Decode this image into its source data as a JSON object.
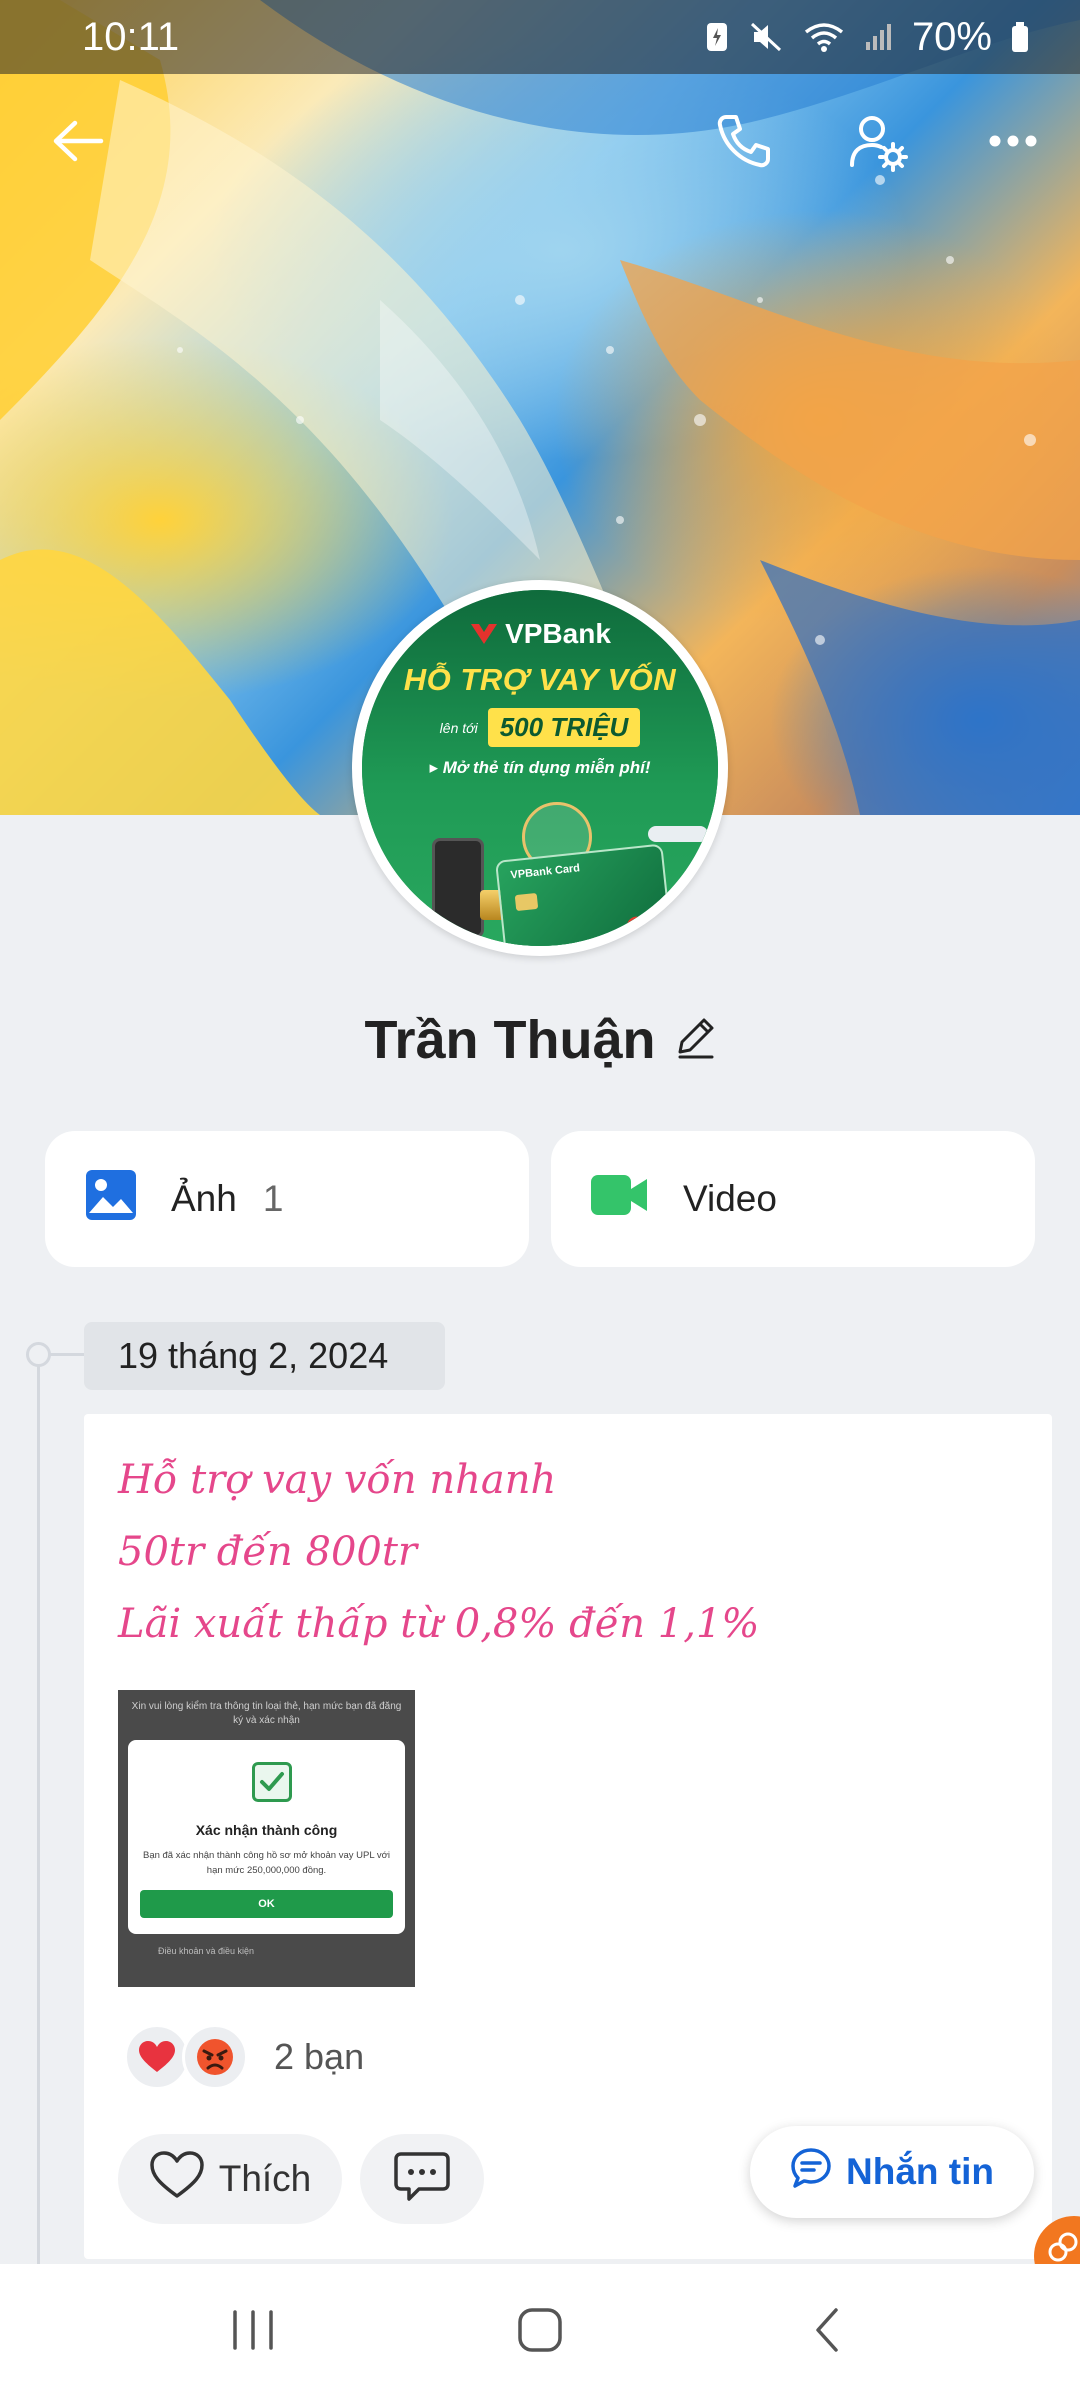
{
  "status_bar": {
    "time": "10:11",
    "battery": "70%"
  },
  "profile": {
    "name": "Trần Thuận"
  },
  "avatar_ad": {
    "brand": "VPBank",
    "headline": "HỖ TRỢ VAY VỐN",
    "prefix": "lên tới",
    "amount": "500 TRIỆU",
    "subline": "▸ Mở thẻ tín dụng miễn phí!",
    "card_label": "VPBank Card"
  },
  "media": {
    "photos_label": "Ảnh",
    "photos_count": "1",
    "video_label": "Video"
  },
  "timeline": {
    "date": "19 tháng 2, 2024"
  },
  "post": {
    "lines": [
      "Hỗ trợ vay vốn nhanh",
      "50tr đến 800tr",
      "Lãi xuất thấp từ 0,8% đến 1,1%"
    ],
    "image": {
      "top_text": "Xin vui lòng kiểm tra thông tin loại thẻ, hạn mức bạn đã đăng ký và xác nhận",
      "dialog_title": "Xác nhận thành công",
      "dialog_body": "Bạn đã xác nhận thành công hồ sơ mở khoản vay UPL với hạn mức 250,000,000 đồng.",
      "ok_label": "OK",
      "bottom_text": "Điều khoản và điều kiện"
    },
    "reaction_count": "2 bạn",
    "like_label": "Thích"
  },
  "message_button": "Nhắn tin",
  "colors": {
    "accent_blue": "#1463d6",
    "post_text_pink": "#e5478b",
    "video_green": "#34c46a",
    "photo_blue": "#1f6fe0",
    "page_bg": "#eef0f3"
  },
  "icons": [
    "back-arrow-icon",
    "phone-icon",
    "user-settings-icon",
    "more-icon",
    "photo-icon",
    "video-icon",
    "edit-pencil-icon",
    "heart-icon",
    "angry-face-icon",
    "heart-outline-icon",
    "comment-icon",
    "chat-bubble-icon",
    "recents-icon",
    "home-icon",
    "back-icon"
  ]
}
